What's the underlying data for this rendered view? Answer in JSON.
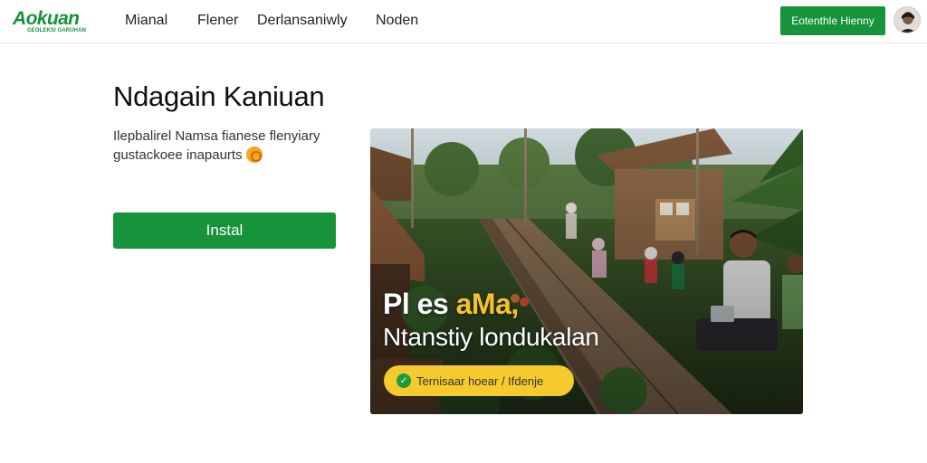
{
  "header": {
    "logo_text": "Aokuan",
    "logo_tagline": "GEOLEKSI GARUHAN",
    "nav": [
      "Mianal",
      "Flener",
      "Derlansaniwly",
      "Noden"
    ],
    "cta_label": "Eotenthle Hienny"
  },
  "hero": {
    "title": "Ndagain Kaniuan",
    "description": "Ilepbalirel Namsa  fianese flenyiary gustackoee inapaurts",
    "install_label": "Instal"
  },
  "image_overlay": {
    "line1_plain": "Pl es",
    "line1_accent": "aMa,",
    "line2": "Ntanstiy londukalan",
    "pill_label": "Ternisaar hoear / Ifdenje"
  },
  "colors": {
    "brand_green": "#17933b",
    "overlay_yellow": "#f6c92d",
    "accent_yellow": "#f6c229"
  },
  "icons": {
    "logo": "check-leaf-icon",
    "description_badge": "sun-badge-icon",
    "pill": "check-circle-icon",
    "avatar": "user-avatar"
  }
}
